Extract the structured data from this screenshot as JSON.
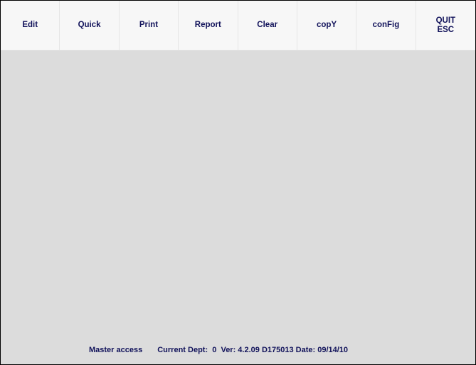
{
  "menu": {
    "edit": "Edit",
    "quick": "Quick",
    "print": "Print",
    "report": "Report",
    "clear": "Clear",
    "copy": "copY",
    "config": "conFig",
    "quit_line1": "QUIT",
    "quit_line2": "ESC"
  },
  "status": {
    "access": "Master access",
    "info": "Current Dept:  0  Ver: 4.2.09 D175013 Date: 09/14/10"
  },
  "colors": {
    "text": "#11125a",
    "menu_background": "#f7f7f7",
    "workspace_background": "#dcdcdc",
    "border": "#000000"
  }
}
